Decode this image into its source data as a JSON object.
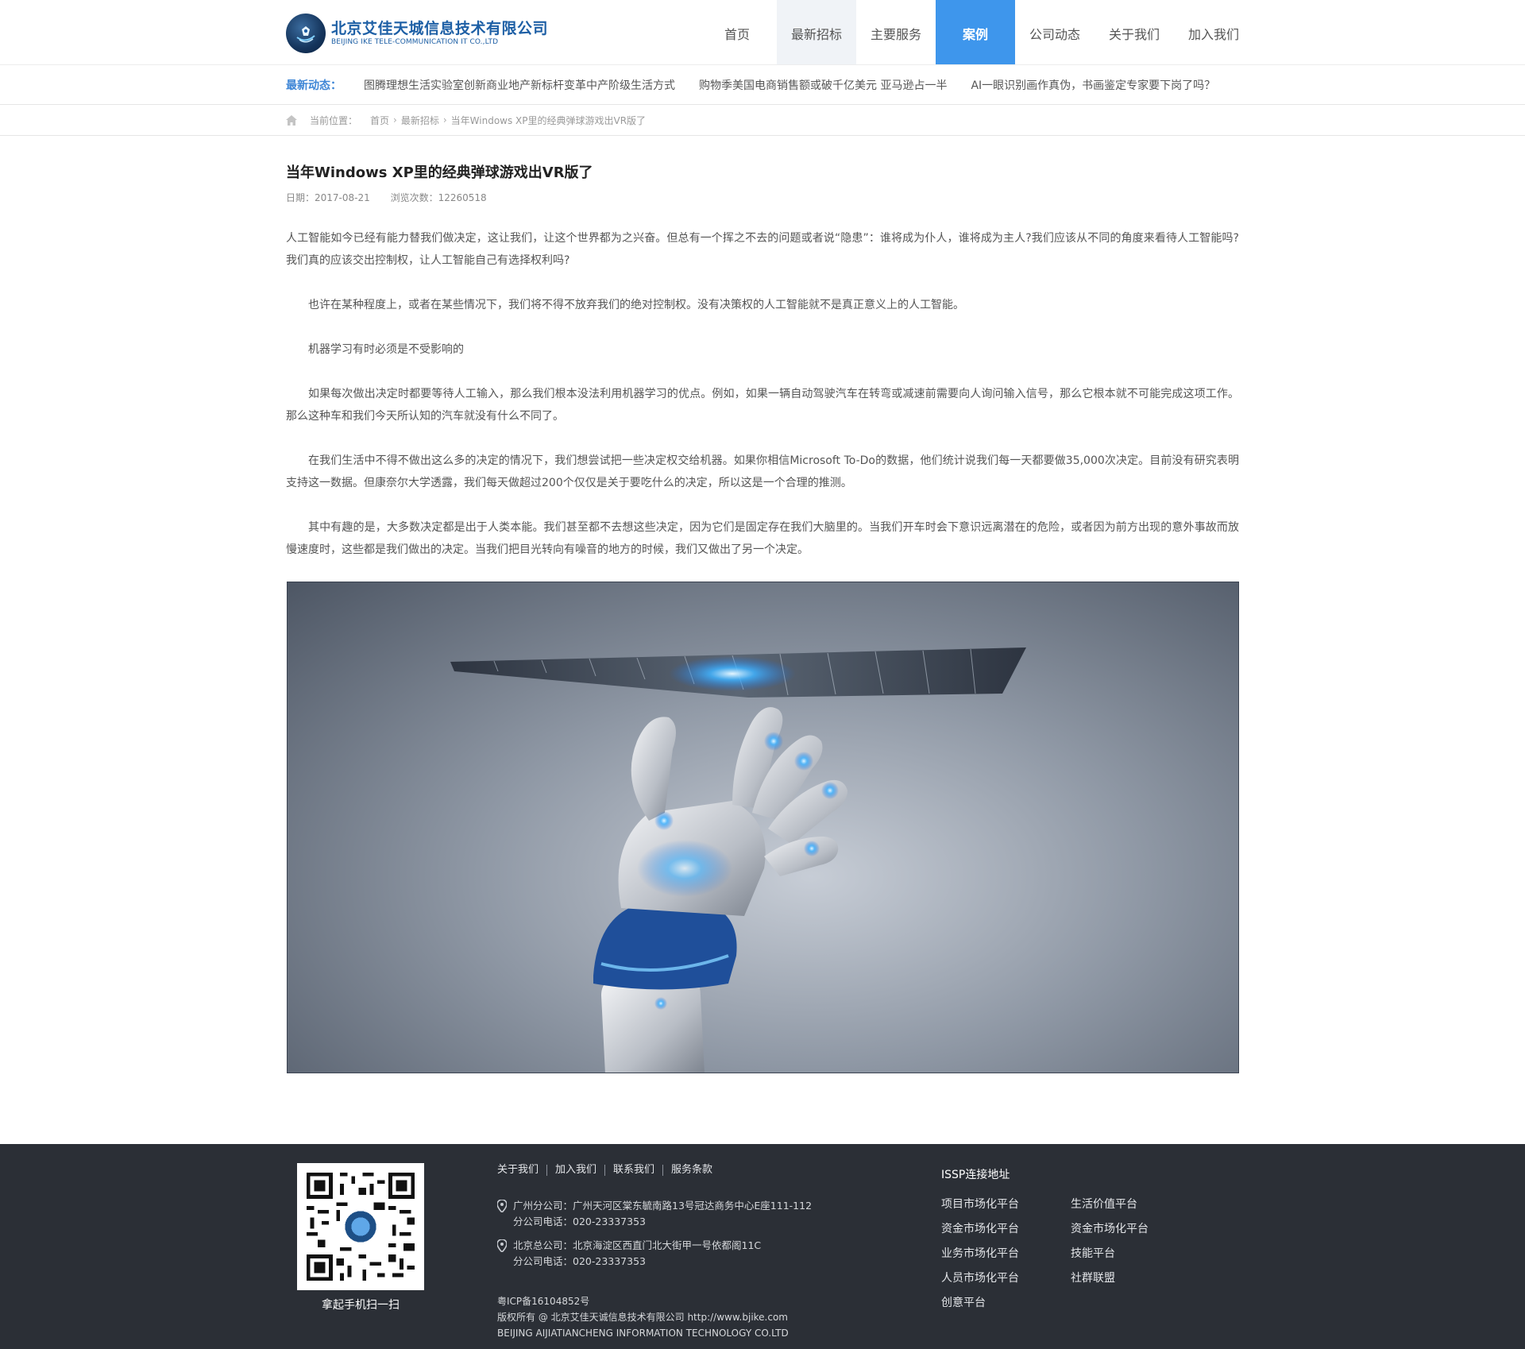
{
  "header": {
    "logo_cn": "北京艾佳天城信息技术有限公司",
    "logo_en": "BEIJING IKE TELE-COMMUNICATION IT CO.,LTD",
    "nav": [
      {
        "label": "首页"
      },
      {
        "label": "最新招标"
      },
      {
        "label": "主要服务"
      },
      {
        "label": "案例"
      },
      {
        "label": "公司动态"
      },
      {
        "label": "关于我们"
      },
      {
        "label": "加入我们"
      }
    ]
  },
  "ticker": {
    "label": "最新动态：",
    "items": [
      "图腾理想生活实验室创新商业地产新标杆变革中产阶级生活方式",
      "购物季美国电商销售额或破千亿美元 亚马逊占一半",
      "AI一眼识别画作真伪，书画鉴定专家要下岗了吗？"
    ]
  },
  "breadcrumb": {
    "label": "当前位置：",
    "home": "首页",
    "section": "最新招标",
    "current": "当年Windows XP里的经典弹球游戏出VR版了"
  },
  "article": {
    "title": "当年Windows XP里的经典弹球游戏出VR版了",
    "date": "日期：2017-08-21",
    "views": "浏览次数：12260518",
    "paragraphs": [
      "人工智能如今已经有能力替我们做决定，这让我们，让这个世界都为之兴奋。但总有一个挥之不去的问题或者说“隐患”：谁将成为仆人，谁将成为主人?我们应该从不同的角度来看待人工智能吗?我们真的应该交出控制权，让人工智能自己有选择权利吗?",
      "也许在某种程度上，或者在某些情况下，我们将不得不放弃我们的绝对控制权。没有决策权的人工智能就不是真正意义上的人工智能。",
      "机器学习有时必须是不受影响的",
      "如果每次做出决定时都要等待人工输入，那么我们根本没法利用机器学习的优点。例如，如果一辆自动驾驶汽车在转弯或减速前需要向人询问输入信号，那么它根本就不可能完成这项工作。那么这种车和我们今天所认知的汽车就没有什么不同了。",
      "在我们生活中不得不做出这么多的决定的情况下，我们想尝试把一些决定权交给机器。如果你相信Microsoft To-Do的数据，他们统计说我们每一天都要做35,000次决定。目前没有研究表明支持这一数据。但康奈尔大学透露，我们每天做超过200个仅仅是关于要吃什么的决定，所以这是一个合理的推测。",
      "其中有趣的是，大多数决定都是出于人类本能。我们甚至都不去想这些决定，因为它们是固定存在我们大脑里的。当我们开车时会下意识远离潜在的危险，或者因为前方出现的意外事故而放慢速度时，这些都是我们做出的决定。当我们把目光转向有噪音的地方的时候，我们又做出了另一个决定。"
    ]
  },
  "footer": {
    "qr_caption": "拿起手机扫一扫",
    "links": [
      "关于我们",
      "加入我们",
      "联系我们",
      "服务条款"
    ],
    "address1": {
      "line1": "广州分公司：广州天河区棠东毓南路13号冠达商务中心E座111-112",
      "line2": "分公司电话：020-23337353"
    },
    "address2": {
      "line1": "北京总公司：北京海淀区西直门北大街甲一号依都阁11C",
      "line2": "分公司电话：020-23337353"
    },
    "icp": "粤ICP备16104852号",
    "copyright": "版权所有 @ 北京艾佳天诚信息技术有限公司 http://www.bjike.com",
    "company_en": "BEIJING AIJIATIANCHENG INFORMATION TECHNOLOGY CO.LTD",
    "issp_title": "ISSP连接地址",
    "issp_links": [
      "项目市场化平台",
      "生活价值平台",
      "资金市场化平台",
      "资金市场化平台",
      "业务市场化平台",
      "技能平台",
      "人员市场化平台",
      "社群联盟",
      "创意平台"
    ]
  },
  "colors": {
    "accent": "#3e96ec",
    "brand": "#1d5fa5",
    "footer_bg": "#2b2f36"
  }
}
